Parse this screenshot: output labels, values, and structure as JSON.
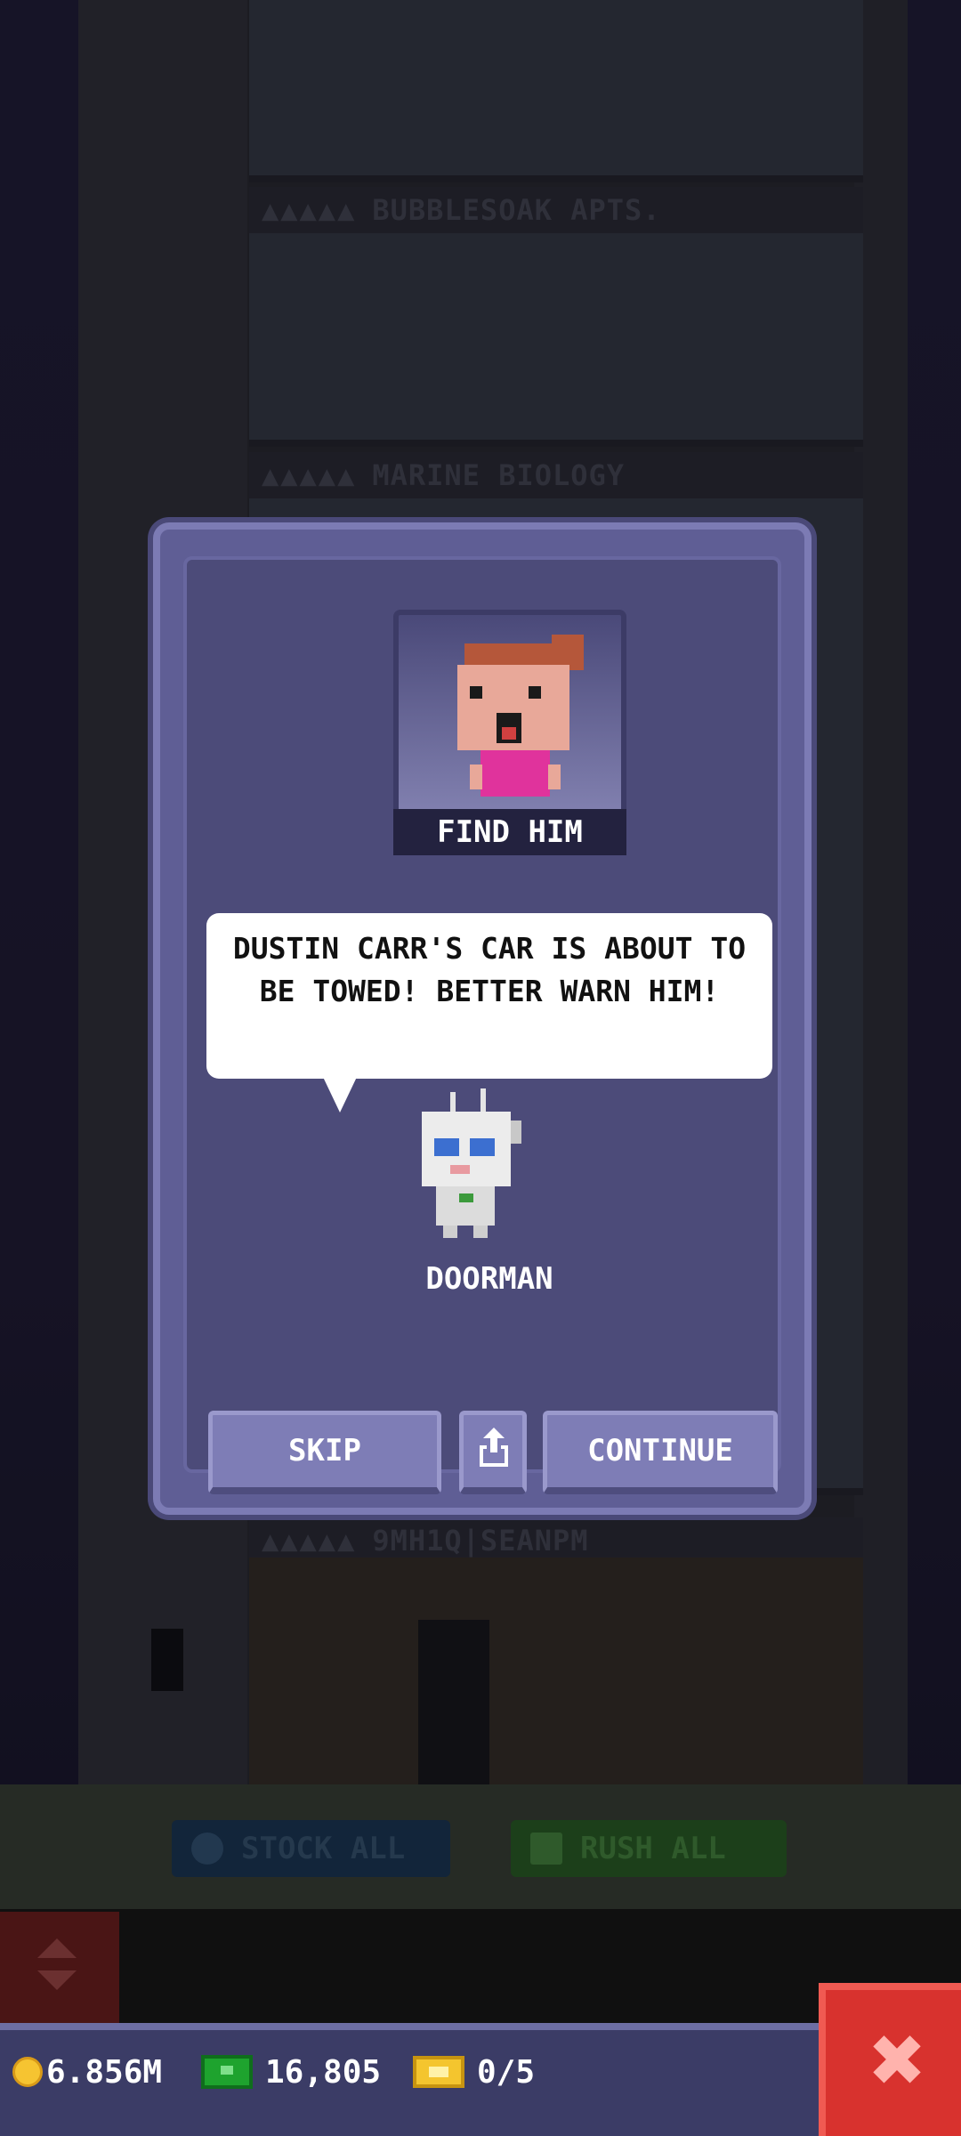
{
  "background": {
    "floors": [
      {
        "label": "BUBBLESOAK APTS.",
        "stars": "▲▲▲▲▲"
      },
      {
        "label": "MARINE BIOLOGY",
        "stars": "▲▲▲▲▲"
      },
      {
        "label": "9MH1Q|SEANPM",
        "stars": "▲▲▲▲▲"
      }
    ],
    "actions": {
      "stock_all": "STOCK ALL",
      "rush_all": "RUSH ALL"
    }
  },
  "dialog": {
    "portrait_label": "FIND HIM",
    "message": "DUSTIN CARR'S CAR IS ABOUT TO BE TOWED! BETTER WARN HIM!",
    "npc_name": "DOORMAN",
    "buttons": {
      "skip": "SKIP",
      "continue": "CONTINUE"
    }
  },
  "status": {
    "coins": "6.856M",
    "bux": "16,805",
    "tickets": "0/5"
  },
  "colors": {
    "dialog_bg": "#4c4b79",
    "button": "#7e7db6",
    "close": "#d8322e",
    "coin": "#f6c431",
    "bux": "#1ea32e"
  },
  "icons": [
    "share-icon",
    "coin-icon",
    "bux-icon",
    "ticket-icon",
    "close-icon",
    "elevator-up-icon",
    "elevator-down-icon"
  ]
}
